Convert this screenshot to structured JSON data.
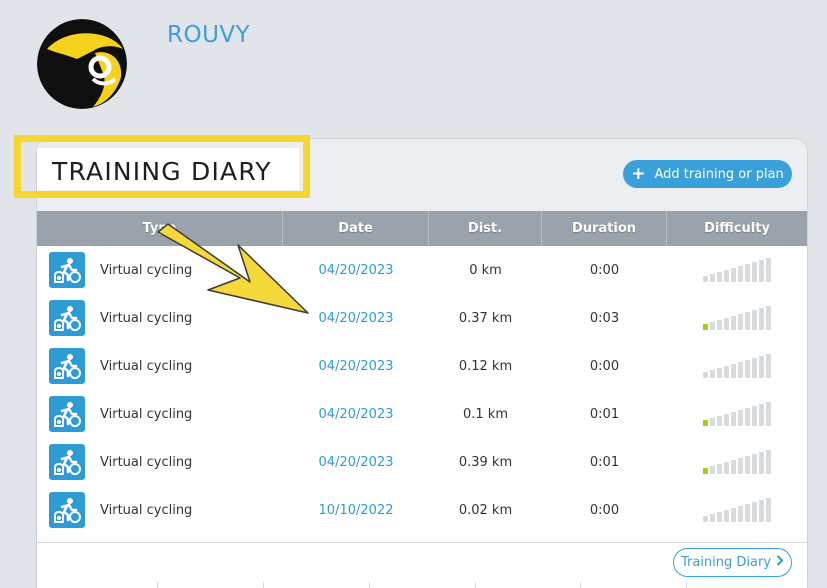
{
  "brand": {
    "name": "ROUVY"
  },
  "page": {
    "title": "TRAINING DIARY"
  },
  "actions": {
    "add_label": "Add training or plan",
    "diary_label": "Training Diary"
  },
  "table": {
    "columns": [
      "Type",
      "Date",
      "Dist.",
      "Duration",
      "Difficulty"
    ],
    "rows": [
      {
        "type": "Virtual cycling",
        "date": "04/20/2023",
        "dist": "0 km",
        "duration": "0:00",
        "difficulty": 0
      },
      {
        "type": "Virtual cycling",
        "date": "04/20/2023",
        "dist": "0.37 km",
        "duration": "0:03",
        "difficulty": 1
      },
      {
        "type": "Virtual cycling",
        "date": "04/20/2023",
        "dist": "0.12 km",
        "duration": "0:00",
        "difficulty": 0
      },
      {
        "type": "Virtual cycling",
        "date": "04/20/2023",
        "dist": "0.1 km",
        "duration": "0:01",
        "difficulty": 1
      },
      {
        "type": "Virtual cycling",
        "date": "04/20/2023",
        "dist": "0.39 km",
        "duration": "0:01",
        "difficulty": 1
      },
      {
        "type": "Virtual cycling",
        "date": "10/10/2022",
        "dist": "0.02 km",
        "duration": "0:00",
        "difficulty": 0
      }
    ],
    "difficulty_max": 10
  },
  "colors": {
    "accent": "#3aa0da",
    "header_gray": "#9aa2ab",
    "highlight": "#f7d72f",
    "difficulty_on": "#a6ce1c",
    "difficulty_off": "#d8dcdf"
  }
}
